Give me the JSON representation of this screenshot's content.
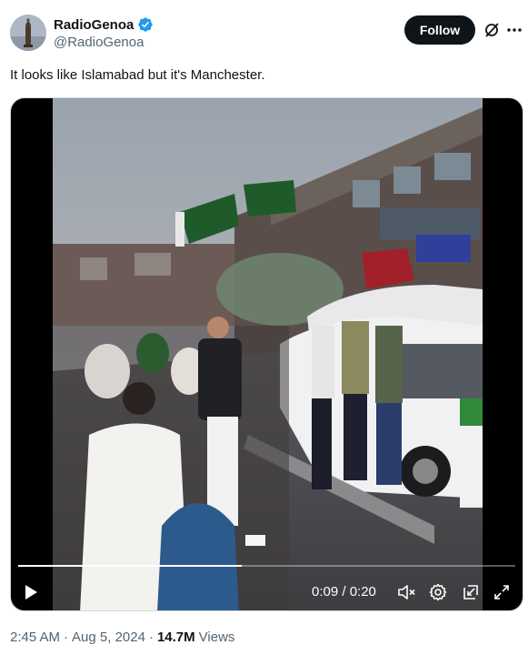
{
  "author": {
    "display_name": "RadioGenoa",
    "handle": "@RadioGenoa",
    "verified": true,
    "verified_color": "#1d9bf0"
  },
  "actions": {
    "follow_label": "Follow",
    "grok_icon": "grok-icon",
    "more_icon": "more-icon"
  },
  "post": {
    "text": "It looks like Islamabad but it's Manchester."
  },
  "video": {
    "current_time": "0:09",
    "duration": "0:20",
    "time_display": "0:09 / 0:20",
    "progress": 0.45,
    "controls": [
      "play-icon",
      "mute-icon",
      "settings-icon",
      "pip-icon",
      "fullscreen-icon"
    ]
  },
  "meta": {
    "time": "2:45 AM",
    "separator": "·",
    "date": "Aug 5, 2024",
    "views_count": "14.7M",
    "views_label": "Views"
  },
  "colors": {
    "text_primary": "#0f1419",
    "text_secondary": "#536471",
    "follow_bg": "#0f1419"
  }
}
